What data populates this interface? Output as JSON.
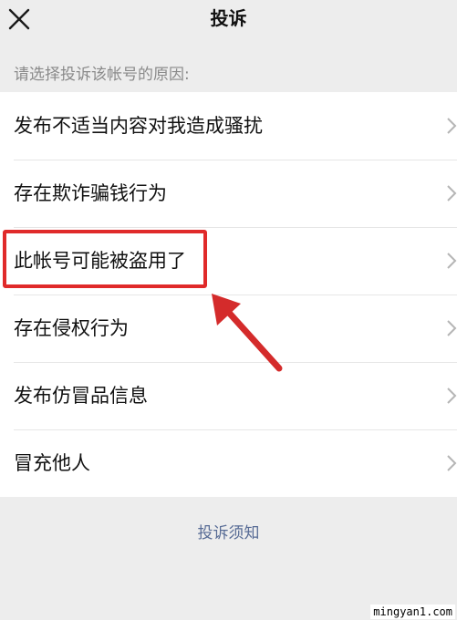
{
  "header": {
    "title": "投诉"
  },
  "section": {
    "prompt": "请选择投诉该帐号的原因:"
  },
  "reasons": [
    {
      "label": "发布不适当内容对我造成骚扰"
    },
    {
      "label": "存在欺诈骗钱行为"
    },
    {
      "label": "此帐号可能被盗用了"
    },
    {
      "label": "存在侵权行为"
    },
    {
      "label": "发布仿冒品信息"
    },
    {
      "label": "冒充他人"
    }
  ],
  "footer": {
    "link": "投诉须知"
  },
  "watermark": "mingyan1.com",
  "icons": {
    "close": "close-icon",
    "chevron": "chevron-right-icon"
  },
  "colors": {
    "highlight": "#e02a2a",
    "link": "#576b95",
    "background": "#ededed"
  }
}
